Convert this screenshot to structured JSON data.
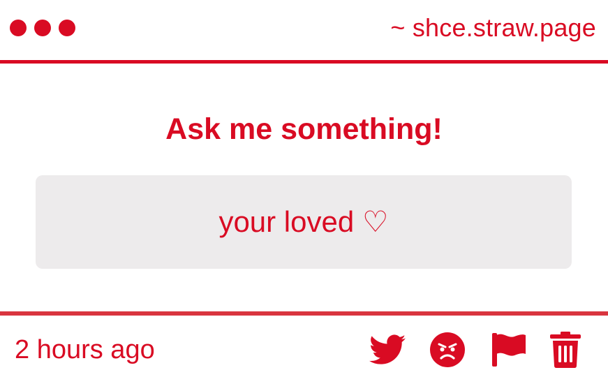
{
  "window": {
    "controls": [
      "dot",
      "dot",
      "dot"
    ],
    "site_url": "~ shce.straw.page"
  },
  "main": {
    "heading": "Ask me something!",
    "answer": "your loved ♡"
  },
  "footer": {
    "timestamp": "2 hours ago",
    "actions": [
      {
        "icon": "twitter-icon"
      },
      {
        "icon": "angry-face-icon"
      },
      {
        "icon": "flag-icon"
      },
      {
        "icon": "trash-icon"
      }
    ]
  },
  "colors": {
    "accent": "#d90b23",
    "box_background": "#edebec",
    "background": "#ffffff"
  }
}
